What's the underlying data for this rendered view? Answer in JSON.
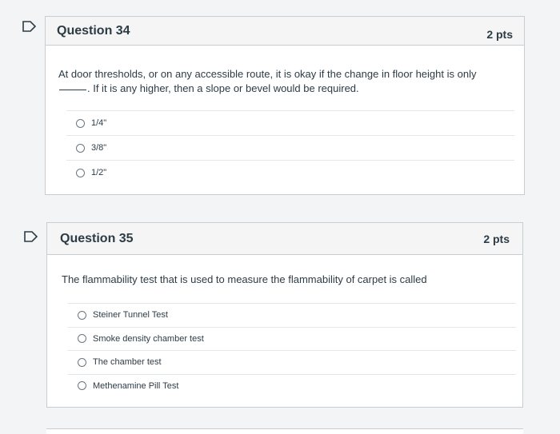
{
  "questions": [
    {
      "title": "Question 34",
      "points": "2 pts",
      "text_before": "At door thresholds, or on any accessible route, it is okay if the change in floor height is only",
      "text_after": ". If it is any higher, then a slope or bevel would be required.",
      "answers": [
        "1/4\"",
        "3/8\"",
        "1/2\""
      ]
    },
    {
      "title": "Question 35",
      "points": "2 pts",
      "text": "The flammability test that is used to measure the flammability of carpet is called",
      "answers": [
        "Steiner Tunnel Test",
        "Smoke density chamber test",
        "The chamber test",
        "Methenamine Pill Test"
      ]
    }
  ]
}
